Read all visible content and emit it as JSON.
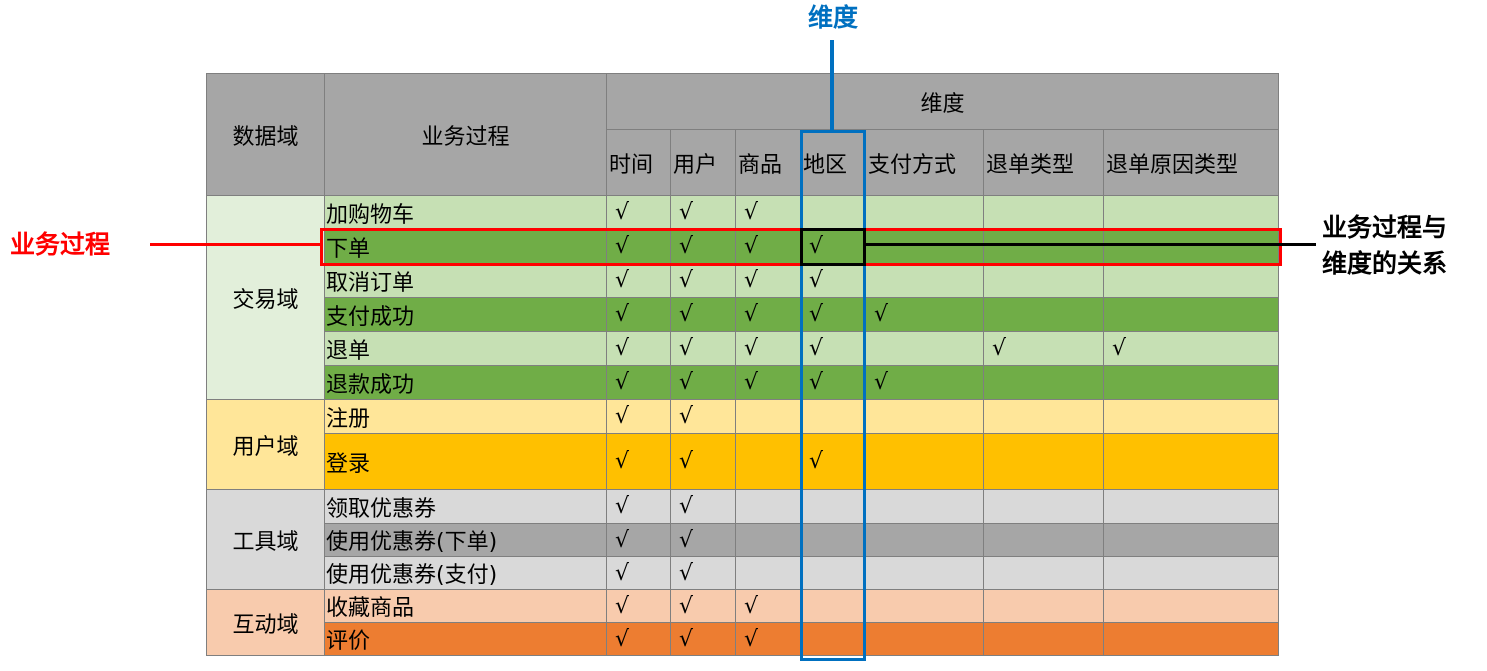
{
  "header": {
    "domain": "数据域",
    "process": "业务过程",
    "dimension_group": "维度",
    "dimensions": [
      "时间",
      "用户",
      "商品",
      "地区",
      "支付方式",
      "退单类型",
      "退单原因类型"
    ]
  },
  "check_symbol": "√",
  "groups": [
    {
      "domain": "交易域",
      "colors": {
        "domain_bg": "#e2efda",
        "light": "#c6e0b4",
        "dark": "#70ad47"
      },
      "rows": [
        {
          "process": "加购物车",
          "shade": "light",
          "marks": [
            1,
            1,
            1,
            0,
            0,
            0,
            0
          ]
        },
        {
          "process": "下单",
          "shade": "dark",
          "marks": [
            1,
            1,
            1,
            1,
            0,
            0,
            0
          ]
        },
        {
          "process": "取消订单",
          "shade": "light",
          "marks": [
            1,
            1,
            1,
            1,
            0,
            0,
            0
          ]
        },
        {
          "process": "支付成功",
          "shade": "dark",
          "marks": [
            1,
            1,
            1,
            1,
            1,
            0,
            0
          ]
        },
        {
          "process": "退单",
          "shade": "light",
          "marks": [
            1,
            1,
            1,
            1,
            0,
            1,
            1
          ]
        },
        {
          "process": "退款成功",
          "shade": "dark",
          "marks": [
            1,
            1,
            1,
            1,
            1,
            0,
            0
          ]
        }
      ]
    },
    {
      "domain": "用户域",
      "colors": {
        "domain_bg": "#ffe699",
        "light": "#ffe699",
        "dark": "#ffc000"
      },
      "rows": [
        {
          "process": "注册",
          "shade": "light",
          "marks": [
            1,
            1,
            0,
            0,
            0,
            0,
            0
          ]
        },
        {
          "process": "登录",
          "shade": "dark",
          "marks": [
            1,
            1,
            0,
            1,
            0,
            0,
            0
          ]
        }
      ]
    },
    {
      "domain": "工具域",
      "colors": {
        "domain_bg": "#d9d9d9",
        "light": "#d9d9d9",
        "dark": "#a6a6a6"
      },
      "rows": [
        {
          "process": "领取优惠券",
          "shade": "light",
          "marks": [
            1,
            1,
            0,
            0,
            0,
            0,
            0
          ]
        },
        {
          "process": "使用优惠券(下单)",
          "shade": "dark",
          "marks": [
            1,
            1,
            0,
            0,
            0,
            0,
            0
          ]
        },
        {
          "process": "使用优惠券(支付)",
          "shade": "light",
          "marks": [
            1,
            1,
            0,
            0,
            0,
            0,
            0
          ]
        }
      ]
    },
    {
      "domain": "互动域",
      "colors": {
        "domain_bg": "#f8cbad",
        "light": "#f8cbad",
        "dark": "#ed7d31"
      },
      "rows": [
        {
          "process": "收藏商品",
          "shade": "light",
          "marks": [
            1,
            1,
            1,
            0,
            0,
            0,
            0
          ]
        },
        {
          "process": "评价",
          "shade": "dark",
          "marks": [
            1,
            1,
            1,
            0,
            0,
            0,
            0
          ]
        }
      ]
    }
  ],
  "annotations": {
    "dimension_label": "维度",
    "process_label": "业务过程",
    "relation_label_line1": "业务过程与",
    "relation_label_line2": "维度的关系",
    "colors": {
      "blue": "#0070c0",
      "red": "#ff0000",
      "black": "#000000"
    }
  }
}
